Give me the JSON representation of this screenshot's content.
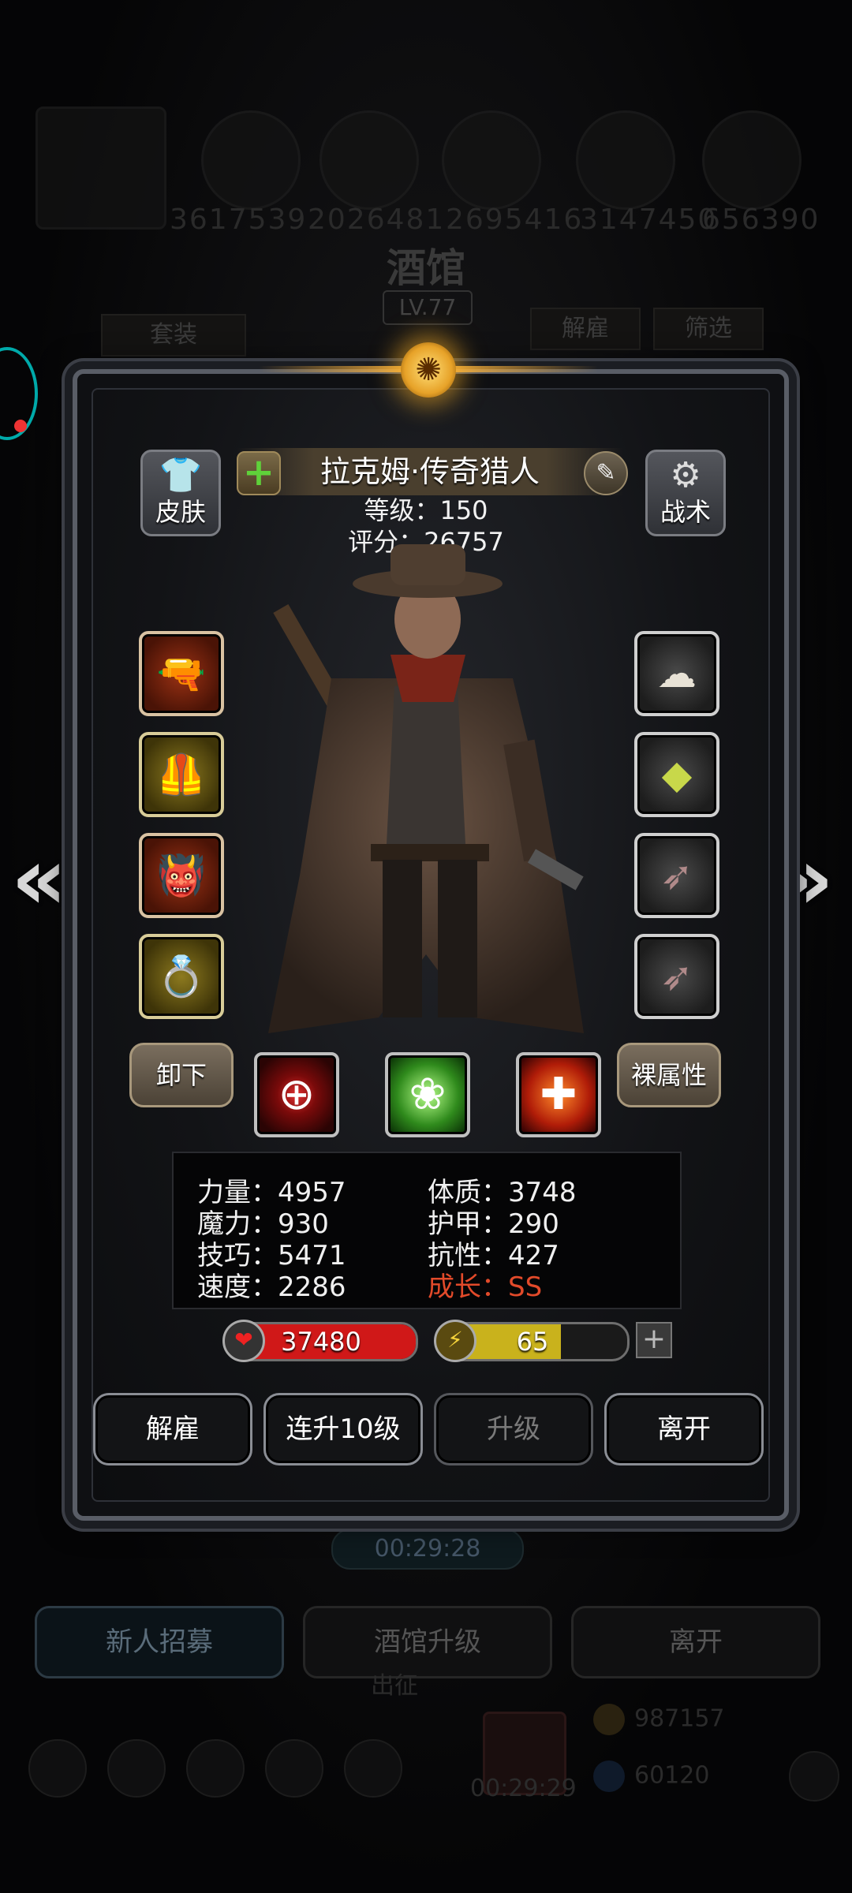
{
  "background": {
    "top_numbers": [
      "3617539",
      "2026481",
      "2695416",
      "3147450",
      "656390"
    ],
    "title": "酒馆",
    "level": "LV.77",
    "tabs": {
      "suit": "套装",
      "dismiss": "解雇",
      "filter": "筛选"
    },
    "timer": "00:29:28",
    "buttons": {
      "recruit": "新人招募",
      "upgrade_tavern": "酒馆升级",
      "leave": "离开"
    },
    "bottom_label": "出征",
    "resources": {
      "gold": "987157",
      "gems": "60120"
    },
    "bottom_timer": "00:29:29"
  },
  "hero": {
    "name": "拉克姆·传奇猎人",
    "level_label": "等级：150",
    "score_label": "评分：26757"
  },
  "side_buttons": {
    "skin": "皮肤",
    "tactics": "战术"
  },
  "equipment": {
    "left": [
      "rifle-icon",
      "armor-icon",
      "demon-mask-icon",
      "ring-icon"
    ],
    "right": [
      "cloud-amulet-icon",
      "gem-icon",
      "feather-icon",
      "feather-icon"
    ]
  },
  "actions_row": {
    "unequip": "卸下",
    "base_attributes": "裸属性"
  },
  "skills": [
    "crosshair-skill-icon",
    "ghost-skill-icon",
    "cross-skill-icon"
  ],
  "stats": {
    "strength": "力量：4957",
    "magic": "魔力：930",
    "skill": "技巧：5471",
    "speed": "速度：2286",
    "constitution": "体质：3748",
    "armor": "护甲：290",
    "resistance": "抗性：427",
    "growth": "成长：SS"
  },
  "hp": {
    "value": "37480",
    "fill": 1.0,
    "color": "#d01818"
  },
  "energy": {
    "value": "65",
    "fill": 0.65,
    "color": "#c9b21c"
  },
  "footer_buttons": {
    "dismiss": "解雇",
    "level_up_10": "连升10级",
    "upgrade": "升级",
    "leave": "离开"
  },
  "colors": {
    "growth": "#e24a2a",
    "accent": "#ffb43a"
  }
}
